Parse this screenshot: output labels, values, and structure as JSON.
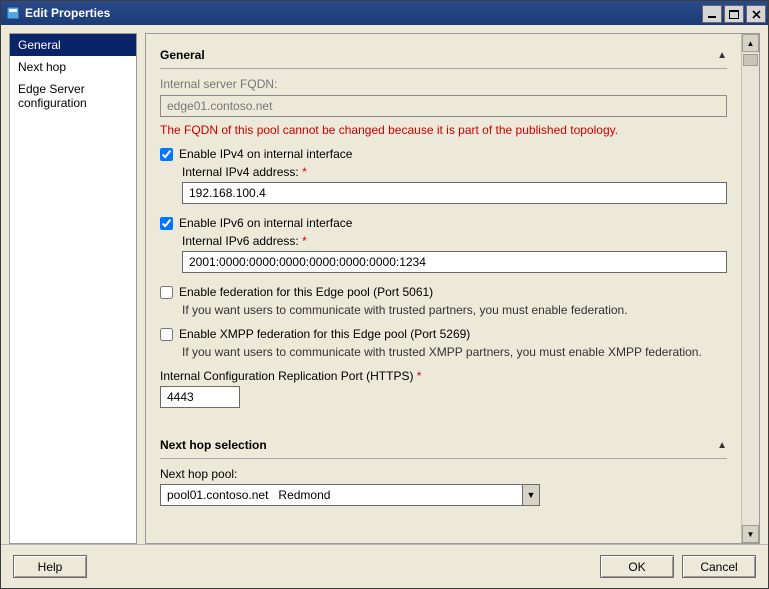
{
  "window": {
    "title": "Edit Properties"
  },
  "nav": {
    "items": [
      {
        "label": "General",
        "selected": true
      },
      {
        "label": "Next hop",
        "selected": false
      },
      {
        "label": "Edge Server configuration",
        "selected": false
      }
    ]
  },
  "general": {
    "section_title": "General",
    "fqdn_label": "Internal server FQDN:",
    "fqdn_value": "edge01.contoso.net",
    "fqdn_warning": "The FQDN of this pool cannot be changed because it is part of the published topology.",
    "ipv4_enable_label": "Enable IPv4 on internal interface",
    "ipv4_enable_checked": true,
    "ipv4_addr_label": "Internal IPv4 address:",
    "ipv4_addr_value": "192.168.100.4",
    "ipv6_enable_label": "Enable IPv6 on internal interface",
    "ipv6_enable_checked": true,
    "ipv6_addr_label": "Internal IPv6 address:",
    "ipv6_addr_value": "2001:0000:0000:0000:0000:0000:0000:1234",
    "federation_enable_label": "Enable federation for this Edge pool (Port 5061)",
    "federation_enable_checked": false,
    "federation_hint": "If you want users to communicate with trusted partners, you must enable federation.",
    "xmpp_enable_label": "Enable XMPP federation for this Edge pool (Port 5269)",
    "xmpp_enable_checked": false,
    "xmpp_hint": "If you want users to communicate with trusted XMPP partners, you must enable XMPP federation.",
    "replication_port_label": "Internal Configuration Replication Port (HTTPS)",
    "replication_port_value": "4443"
  },
  "nexthop": {
    "section_title": "Next hop selection",
    "pool_label": "Next hop pool:",
    "pool_value": "pool01.contoso.net   Redmond"
  },
  "buttons": {
    "help": "Help",
    "ok": "OK",
    "cancel": "Cancel"
  },
  "required_marker": "*"
}
